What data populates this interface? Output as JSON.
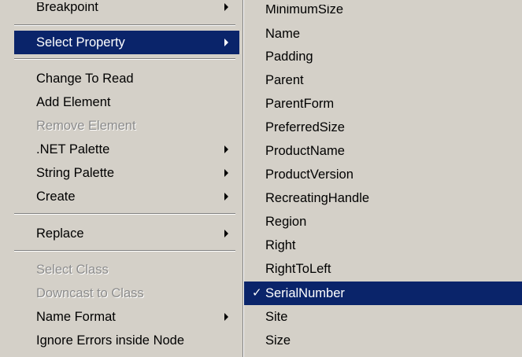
{
  "left_menu": {
    "items": [
      {
        "label": "Breakpoint",
        "disabled": false,
        "submenu": true
      },
      {
        "label": "Select Property",
        "disabled": false,
        "submenu": true,
        "highlighted": true
      },
      {
        "label": "Change To Read",
        "disabled": false,
        "submenu": false
      },
      {
        "label": "Add Element",
        "disabled": false,
        "submenu": false
      },
      {
        "label": "Remove Element",
        "disabled": true,
        "submenu": false
      },
      {
        "label": ".NET Palette",
        "disabled": false,
        "submenu": true
      },
      {
        "label": "String Palette",
        "disabled": false,
        "submenu": true
      },
      {
        "label": "Create",
        "disabled": false,
        "submenu": true
      },
      {
        "label": "Replace",
        "disabled": false,
        "submenu": true
      },
      {
        "label": "Select Class",
        "disabled": true,
        "submenu": false
      },
      {
        "label": "Downcast to Class",
        "disabled": true,
        "submenu": false
      },
      {
        "label": "Name Format",
        "disabled": false,
        "submenu": true
      },
      {
        "label": "Ignore Errors inside Node",
        "disabled": false,
        "submenu": false
      }
    ]
  },
  "right_menu": {
    "items": [
      {
        "label": "MinimumSize"
      },
      {
        "label": "Name"
      },
      {
        "label": "Padding"
      },
      {
        "label": "Parent"
      },
      {
        "label": "ParentForm"
      },
      {
        "label": "PreferredSize"
      },
      {
        "label": "ProductName"
      },
      {
        "label": "ProductVersion"
      },
      {
        "label": "RecreatingHandle"
      },
      {
        "label": "Region"
      },
      {
        "label": "Right"
      },
      {
        "label": "RightToLeft"
      },
      {
        "label": "SerialNumber",
        "checked": true,
        "highlighted": true,
        "check_mark": "✓"
      },
      {
        "label": "Site"
      },
      {
        "label": "Size"
      }
    ]
  },
  "colors": {
    "menu_background": "#d4d0c8",
    "highlight": "#0a246a",
    "disabled_text": "#8c8c8c"
  }
}
